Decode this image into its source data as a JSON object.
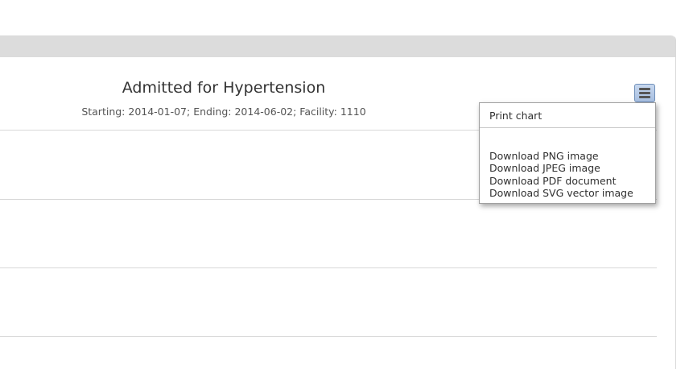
{
  "chart": {
    "title": "Admitted for Hypertension",
    "subtitle": "Starting: 2014-01-07; Ending: 2014-06-02; Facility: 1110"
  },
  "export_menu": {
    "button_icon": "hamburger-menu-icon",
    "items": [
      {
        "label": "Print chart"
      },
      {
        "label": "Download PNG image"
      },
      {
        "label": "Download JPEG image"
      },
      {
        "label": "Download PDF document"
      },
      {
        "label": "Download SVG vector image"
      }
    ]
  },
  "colors": {
    "header_bar": "#dcdcdc",
    "gridline": "#d8d8d8",
    "menu_button": "#a7bfe1",
    "title_text": "#333333"
  }
}
